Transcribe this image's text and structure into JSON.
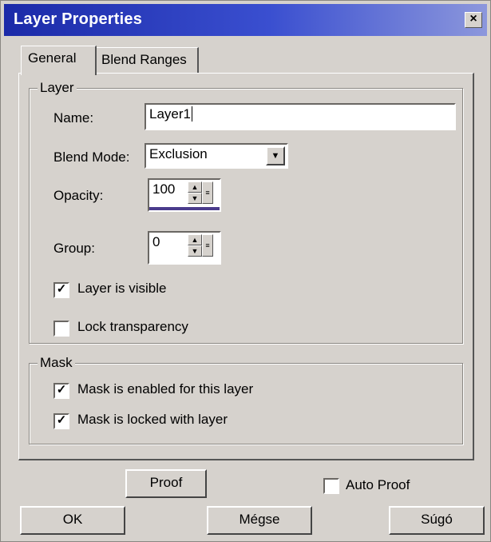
{
  "window": {
    "title": "Layer Properties",
    "close_glyph": "×"
  },
  "tabs": [
    {
      "label": "General"
    },
    {
      "label": "Blend Ranges"
    }
  ],
  "layer_group": {
    "label": "Layer",
    "name_label": "Name:",
    "name_value": "Layer1",
    "blend_mode_label": "Blend Mode:",
    "blend_mode_value": "Exclusion",
    "opacity_label": "Opacity:",
    "opacity_value": "100",
    "group_label": "Group:",
    "group_value": "0",
    "visible_label": "Layer is visible",
    "visible_checked": true,
    "lock_label": "Lock transparency",
    "lock_checked": false
  },
  "mask_group": {
    "label": "Mask",
    "enabled_label": "Mask is enabled for this layer",
    "enabled_checked": true,
    "locked_label": "Mask is locked with layer",
    "locked_checked": true
  },
  "footer": {
    "proof_label": "Proof",
    "auto_proof_label": "Auto Proof",
    "auto_proof_checked": false,
    "ok_label": "OK",
    "cancel_label": "Mégse",
    "help_label": "Súgó"
  },
  "icons": {
    "checkmark": "check-icon",
    "dropdown": "chevron-down-icon",
    "spin_up": "arrow-up-icon",
    "spin_down": "arrow-down-icon"
  }
}
